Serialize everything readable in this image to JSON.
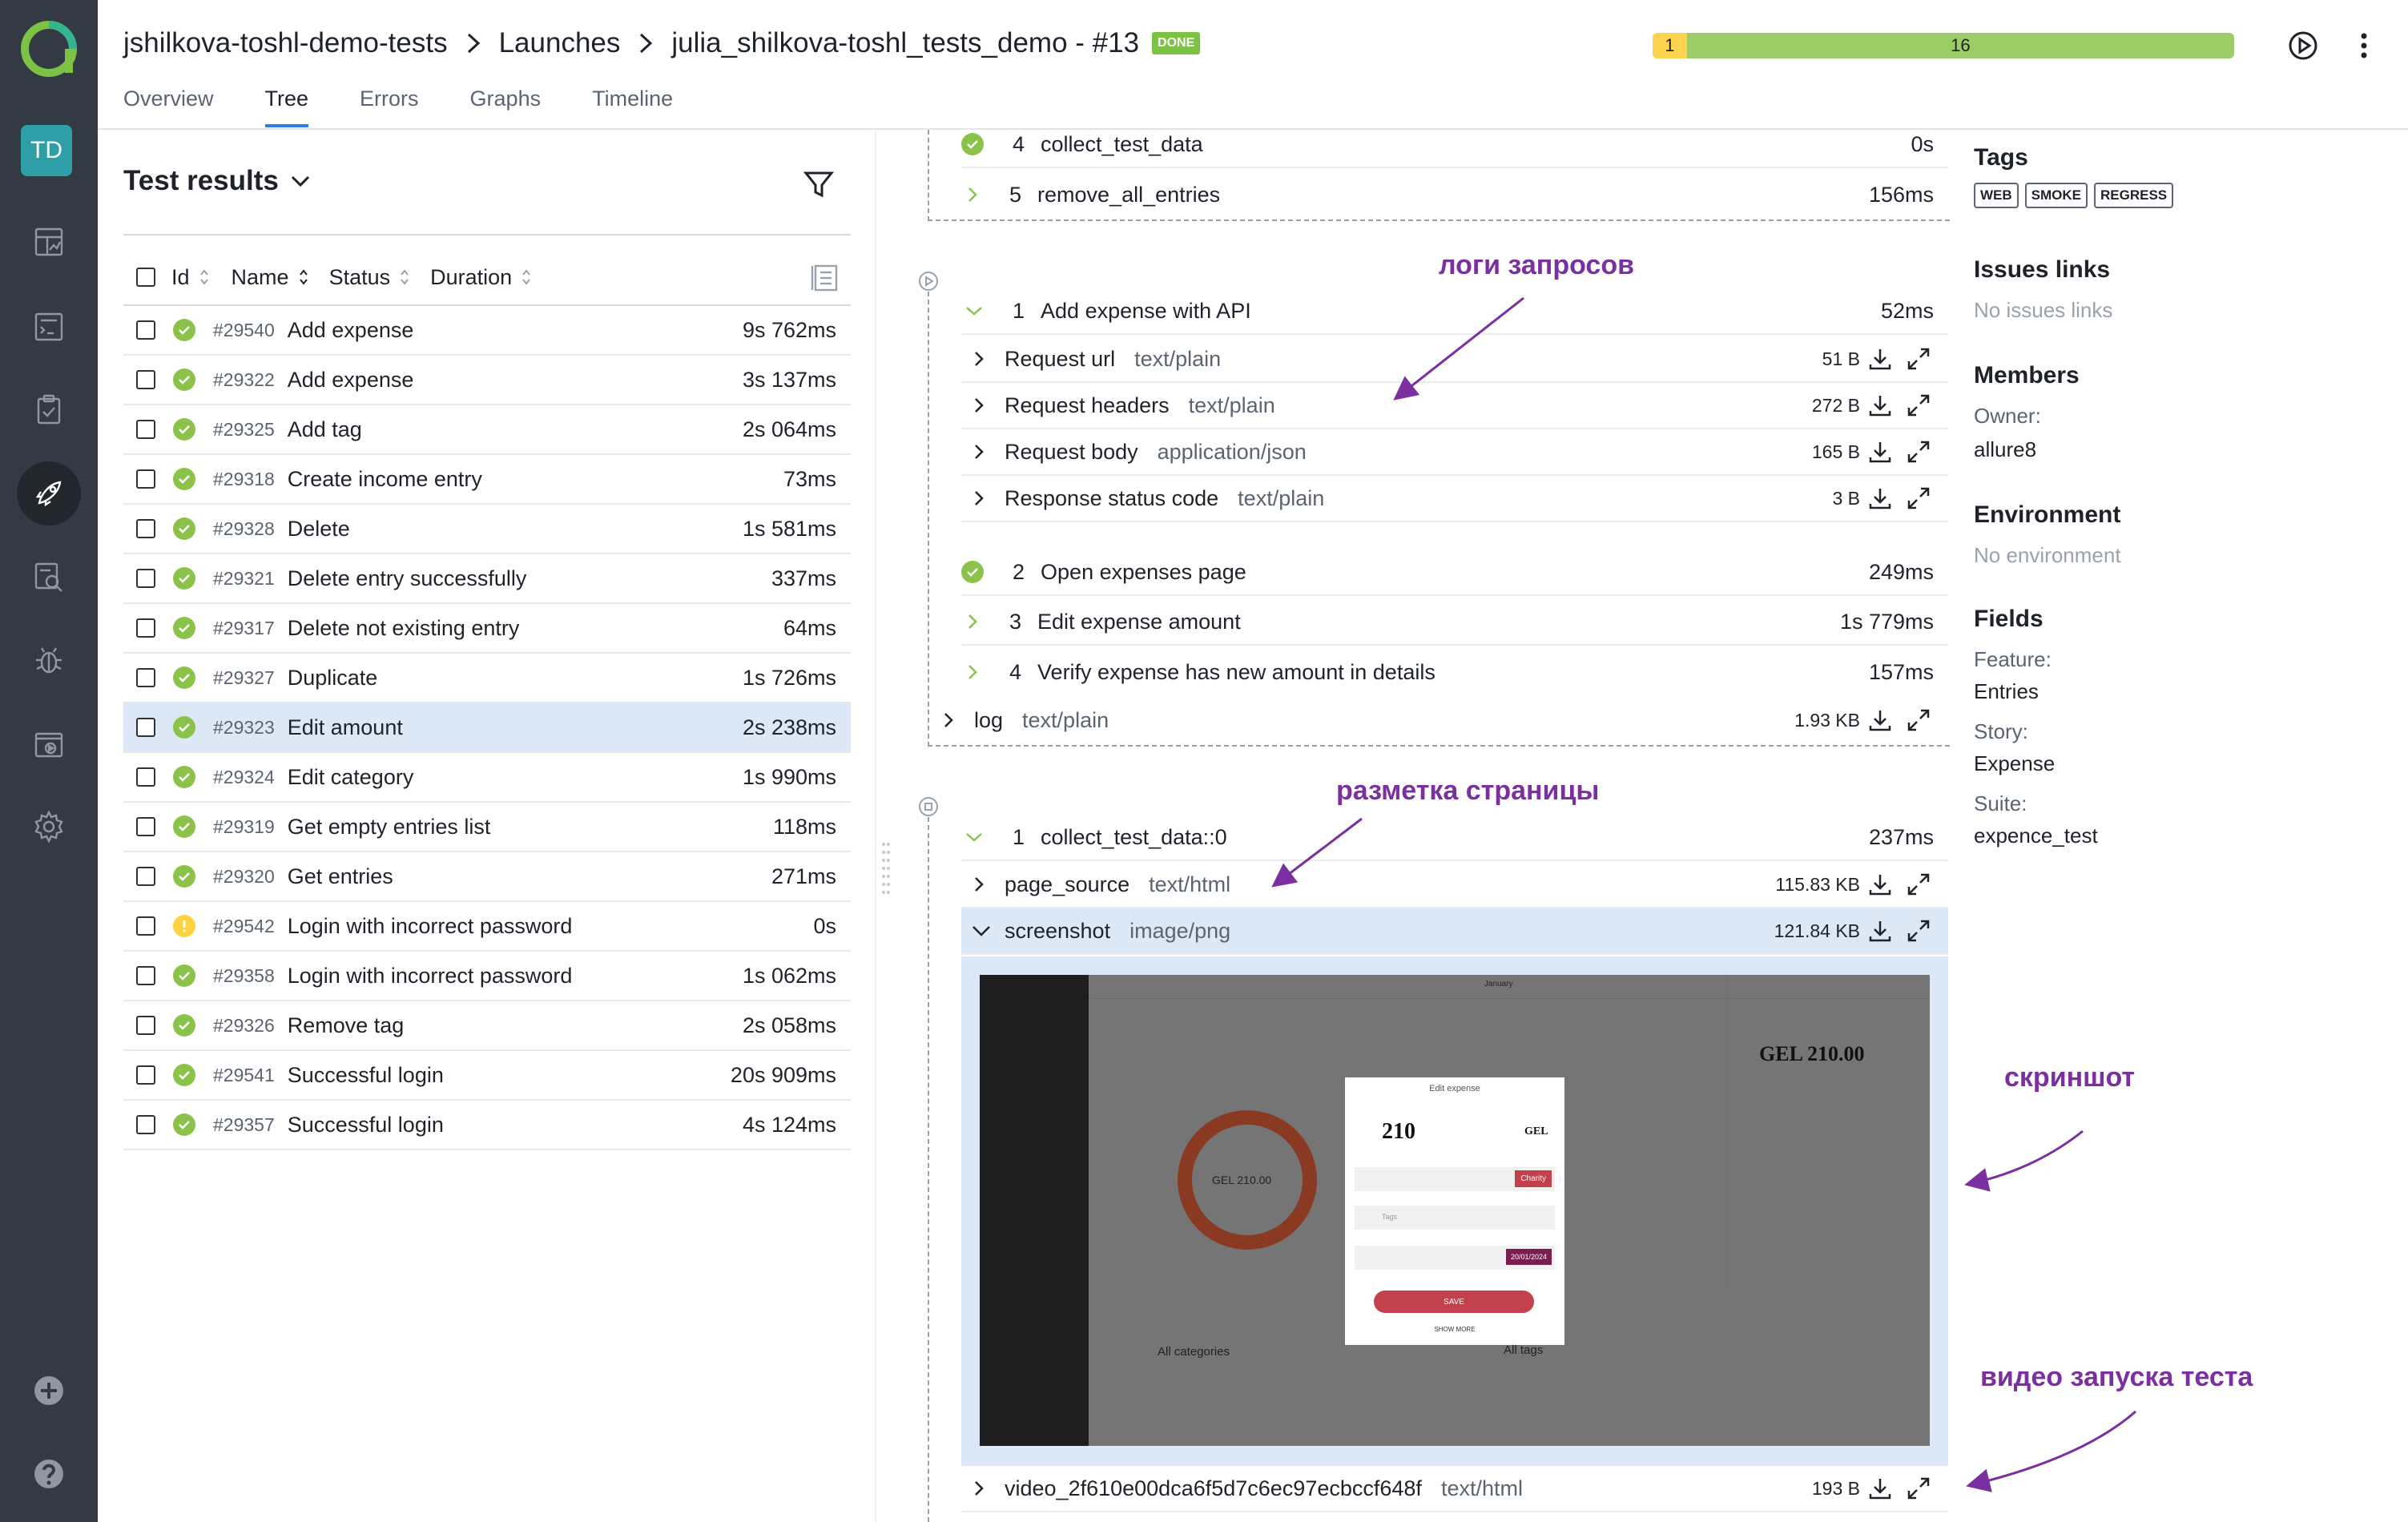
{
  "header": {
    "breadcrumbs": [
      "jshilkova-toshl-demo-tests",
      "Launches",
      "julia_shilkova-toshl_tests_demo - #13"
    ],
    "status_badge": "DONE",
    "tabs": [
      "Overview",
      "Tree",
      "Errors",
      "Graphs",
      "Timeline"
    ],
    "active_tab": "Tree",
    "progress": [
      {
        "label": "1",
        "value": 1,
        "color": "#fbd34d"
      },
      {
        "label": "16",
        "value": 16,
        "color": "#9ccc65"
      }
    ]
  },
  "sidebar": {
    "avatar": "TD",
    "items": [
      "dashboards-icon",
      "testcases-icon",
      "testplans-icon",
      "launches-icon",
      "analytics-icon",
      "defects-icon",
      "jobs-icon",
      "settings-icon"
    ],
    "active": "launches-icon",
    "bottom": [
      "add-icon",
      "help-icon"
    ]
  },
  "test_results": {
    "title": "Test results",
    "columns": [
      "Id",
      "Name",
      "Status",
      "Duration"
    ],
    "rows": [
      {
        "id": "#29540",
        "name": "Add expense",
        "duration": "9s 762ms",
        "status": "passed"
      },
      {
        "id": "#29322",
        "name": "Add expense",
        "duration": "3s 137ms",
        "status": "passed"
      },
      {
        "id": "#29325",
        "name": "Add tag",
        "duration": "2s 064ms",
        "status": "passed"
      },
      {
        "id": "#29318",
        "name": "Create income entry",
        "duration": "73ms",
        "status": "passed"
      },
      {
        "id": "#29328",
        "name": "Delete",
        "duration": "1s 581ms",
        "status": "passed"
      },
      {
        "id": "#29321",
        "name": "Delete entry successfully",
        "duration": "337ms",
        "status": "passed"
      },
      {
        "id": "#29317",
        "name": "Delete not existing entry",
        "duration": "64ms",
        "status": "passed"
      },
      {
        "id": "#29327",
        "name": "Duplicate",
        "duration": "1s 726ms",
        "status": "passed"
      },
      {
        "id": "#29323",
        "name": "Edit amount",
        "duration": "2s 238ms",
        "status": "passed",
        "selected": true
      },
      {
        "id": "#29324",
        "name": "Edit category",
        "duration": "1s 990ms",
        "status": "passed"
      },
      {
        "id": "#29319",
        "name": "Get empty entries list",
        "duration": "118ms",
        "status": "passed"
      },
      {
        "id": "#29320",
        "name": "Get entries",
        "duration": "271ms",
        "status": "passed"
      },
      {
        "id": "#29542",
        "name": "Login with incorrect password",
        "duration": "0s",
        "status": "broken"
      },
      {
        "id": "#29358",
        "name": "Login with incorrect password",
        "duration": "1s 062ms",
        "status": "passed"
      },
      {
        "id": "#29326",
        "name": "Remove tag",
        "duration": "2s 058ms",
        "status": "passed"
      },
      {
        "id": "#29541",
        "name": "Successful login",
        "duration": "20s 909ms",
        "status": "passed"
      },
      {
        "id": "#29357",
        "name": "Successful login",
        "duration": "4s 124ms",
        "status": "passed"
      }
    ]
  },
  "steps": {
    "setup": [
      {
        "num": "4",
        "name": "collect_test_data",
        "duration": "0s"
      },
      {
        "num": "5",
        "name": "remove_all_entries",
        "duration": "156ms"
      }
    ],
    "body_step1": {
      "num": "1",
      "name": "Add expense with API",
      "duration": "52ms"
    },
    "attachments1": [
      {
        "name": "Request url",
        "mime": "text/plain",
        "size": "51 B"
      },
      {
        "name": "Request headers",
        "mime": "text/plain",
        "size": "272 B"
      },
      {
        "name": "Request body",
        "mime": "application/json",
        "size": "165 B"
      },
      {
        "name": "Response status code",
        "mime": "text/plain",
        "size": "3 B"
      }
    ],
    "body_steps": [
      {
        "num": "2",
        "name": "Open expenses page",
        "duration": "249ms"
      },
      {
        "num": "3",
        "name": "Edit expense amount",
        "duration": "1s 779ms"
      },
      {
        "num": "4",
        "name": "Verify expense has new amount in details",
        "duration": "157ms"
      }
    ],
    "log": {
      "name": "log",
      "mime": "text/plain",
      "size": "1.93 KB"
    },
    "teardown_step": {
      "num": "1",
      "name": "collect_test_data::0",
      "duration": "237ms"
    },
    "attachments2": [
      {
        "name": "page_source",
        "mime": "text/html",
        "size": "115.83 KB"
      },
      {
        "name": "screenshot",
        "mime": "image/png",
        "size": "121.84 KB"
      }
    ],
    "video": {
      "name": "video_2f610e00dca6f5d7c6ec97ecbccf648f",
      "mime": "text/html",
      "size": "193 B"
    }
  },
  "annotations": {
    "requests": "логи запросов",
    "markup": "разметка страницы",
    "screenshot": "скриншот",
    "video": "видео запуска теста"
  },
  "screenshot_content": {
    "top_label": "January",
    "amount": "GEL 210.00",
    "donut_label": "GEL 210.00",
    "dialog_title": "Edit expense",
    "dialog_amount": "210",
    "dialog_currency": "GEL",
    "category_chip": "Charity",
    "date_chip": "20/01/2024",
    "save_label": "SAVE",
    "show_more": "SHOW MORE",
    "all_categories": "All categories",
    "all_tags": "All tags",
    "tags_placeholder": "Tags"
  },
  "right_panel": {
    "tags_title": "Tags",
    "tags": [
      "WEB",
      "SMOKE",
      "REGRESS"
    ],
    "issues_title": "Issues links",
    "issues_empty": "No issues links",
    "members_title": "Members",
    "owner_label": "Owner:",
    "owner_value": "allure8",
    "environment_title": "Environment",
    "environment_empty": "No environment",
    "fields_title": "Fields",
    "fields": [
      {
        "label": "Feature:",
        "value": "Entries"
      },
      {
        "label": "Story:",
        "value": "Expense"
      },
      {
        "label": "Suite:",
        "value": "expence_test"
      }
    ]
  },
  "colors": {
    "sidebar": "#343a43",
    "accent": "#2f7de1",
    "passed": "#8bc34a",
    "broken": "#ffd23f",
    "annotation": "#7b2fa0",
    "selection": "#dde8f7"
  }
}
